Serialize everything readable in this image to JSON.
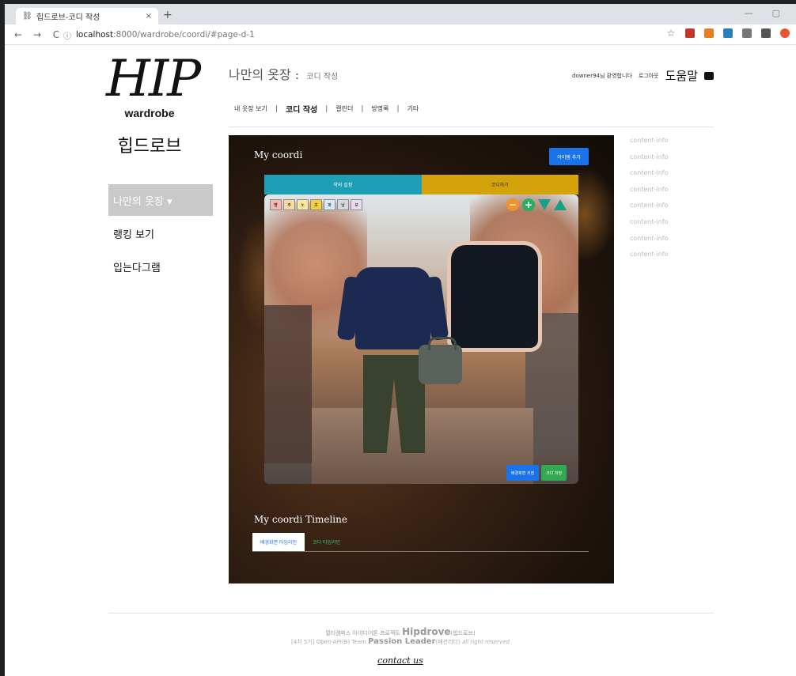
{
  "browser": {
    "tab_title": "힙드로브-코디 작성",
    "tab_close": "×",
    "new_tab": "+",
    "win_min": "—",
    "win_max": "▢",
    "url_host": "localhost",
    "url_path": ":8000/wardrobe/coordi/#page-d-1",
    "back": "←",
    "forward": "→",
    "reload": "C",
    "info": "ⓘ",
    "star": "☆"
  },
  "logo": {
    "big": "HIP",
    "word": "wardrobe",
    "korean": "힙드로브"
  },
  "sidebar": {
    "items": [
      {
        "label": "나만의 옷장 ▾"
      },
      {
        "label": "랭킹 보기"
      },
      {
        "label": "입는다그램"
      }
    ]
  },
  "header": {
    "title": "나만의 옷장 :",
    "subtitle": "코디 작성",
    "nav": [
      "내 옷장 보기",
      "코디 작성",
      "캘린더",
      "방명록",
      "기타"
    ],
    "nav_sep": "|",
    "user": "downer94님 환영합니다",
    "logout": "로그아웃",
    "help": "도움말"
  },
  "content_info": [
    "content-info",
    "content-info",
    "content-info",
    "content-info",
    "content-info",
    "content-info",
    "content-info",
    "content-info"
  ],
  "hero": {
    "title": "My coordi",
    "add_button": "아이템 추가",
    "tab_recommend": "착의 설정",
    "tab_coordi": "코디하기",
    "colors": [
      "빨",
      "주",
      "노",
      "초",
      "파",
      "남",
      "보"
    ],
    "minus": "−",
    "plus": "+",
    "btn_save_bg": "배경화면 저장",
    "btn_save_coordi": "코디 저장",
    "timeline_title": "My coordi Timeline",
    "timeline_tab_1": "배경화면 타임라인",
    "timeline_tab_2": "코디 타임라인"
  },
  "footer": {
    "line1_prefix": "멀티캠퍼스 아이디어톤 프로젝트",
    "line1_brand": "Hipdrove",
    "line1_suffix": "(힙드로브)",
    "line2_prefix": "[4차 5기] Open-API(B) Team",
    "line2_team": "Passion Leader",
    "line2_suffix": "(패션리더)",
    "line2_rights": "all right reserved",
    "contact": "contact us"
  },
  "colors": {
    "accent_blue": "#1a73e8",
    "tab_teal": "#1f9fb5",
    "tab_gold": "#d4a20a",
    "save_green": "#34a853",
    "minus_orange": "#f0932b",
    "plus_green": "#27ae60",
    "arrow_green": "#16a085"
  }
}
